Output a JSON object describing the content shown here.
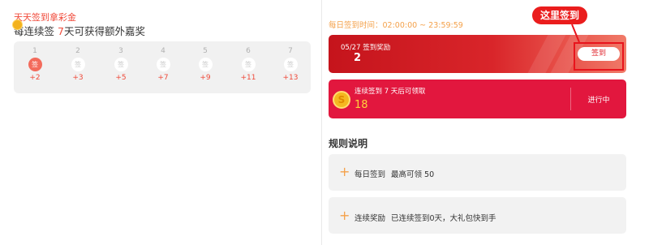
{
  "left": {
    "title": "天天签到拿彩金",
    "subtitle_prefix": "每连续签 ",
    "subtitle_days": "7",
    "subtitle_suffix": "天可获得额外嘉奖",
    "days": [
      {
        "num": "1",
        "icon": "签",
        "bonus": "+2",
        "active": true
      },
      {
        "num": "2",
        "icon": "签",
        "bonus": "+3",
        "active": false
      },
      {
        "num": "3",
        "icon": "签",
        "bonus": "+5",
        "active": false
      },
      {
        "num": "4",
        "icon": "签",
        "bonus": "+7",
        "active": false
      },
      {
        "num": "5",
        "icon": "签",
        "bonus": "+9",
        "active": false
      },
      {
        "num": "6",
        "icon": "签",
        "bonus": "+11",
        "active": false
      },
      {
        "num": "7",
        "icon": "签",
        "bonus": "+13",
        "active": false
      }
    ]
  },
  "right": {
    "time_info": "每日签到时间：02:00:00 ~ 23:59:59",
    "daily": {
      "label": "05/27 签到奖励",
      "value": "2",
      "button": "签到"
    },
    "callout": "这里签到",
    "streak": {
      "label": "连续签到 7 天后可领取",
      "value": "18",
      "status": "进行中",
      "coin_symbol": "S"
    },
    "rules_title": "规则说明",
    "rules": [
      {
        "plus": "+",
        "name": "每日签到",
        "desc": "最高可领 50"
      },
      {
        "plus": "+",
        "name": "连续奖励",
        "desc": "已连续签到0天，大礼包快到手"
      }
    ]
  },
  "colors": {
    "accent_red": "#f04a3a",
    "orange": "#f4a14a",
    "daily_card": "#d9252a",
    "streak_card": "#e2173e",
    "highlight_red": "#e8141c"
  }
}
